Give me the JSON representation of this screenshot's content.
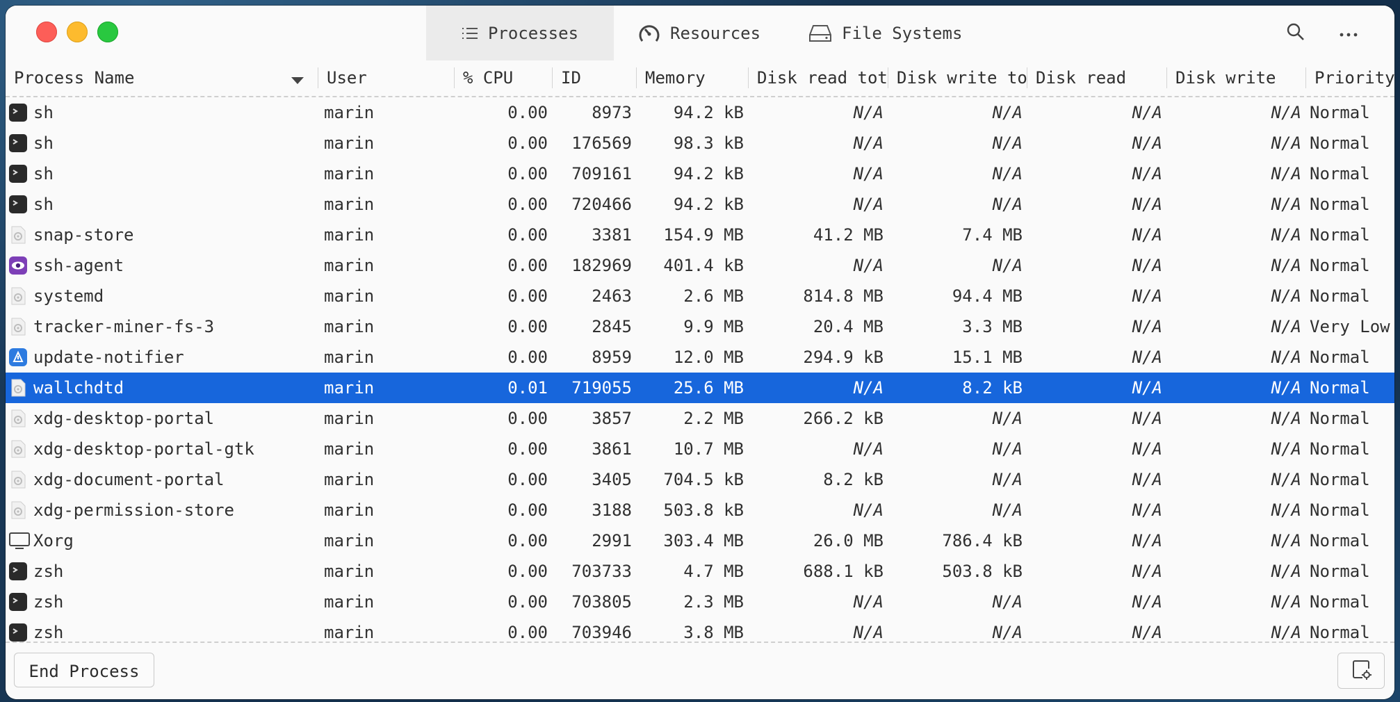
{
  "tabs": [
    {
      "label": "Processes",
      "icon": "list-icon",
      "active": true
    },
    {
      "label": "Resources",
      "icon": "speedometer-icon",
      "active": false
    },
    {
      "label": "File Systems",
      "icon": "drive-icon",
      "active": false
    }
  ],
  "columns": [
    "Process Name",
    "User",
    "% CPU",
    "ID",
    "Memory",
    "Disk read tota",
    "Disk write tot",
    "Disk read",
    "Disk write",
    "Priority"
  ],
  "sort_indicator": "chevron-down-icon",
  "rows": [
    {
      "name": "sh",
      "icon": "terminal-icon",
      "user": "marin",
      "cpu": "0.00",
      "id": "8973",
      "memory": "94.2 kB",
      "disk_read_total": "N/A",
      "disk_write_total": "N/A",
      "disk_read": "N/A",
      "disk_write": "N/A",
      "priority": "Normal"
    },
    {
      "name": "sh",
      "icon": "terminal-icon",
      "user": "marin",
      "cpu": "0.00",
      "id": "176569",
      "memory": "98.3 kB",
      "disk_read_total": "N/A",
      "disk_write_total": "N/A",
      "disk_read": "N/A",
      "disk_write": "N/A",
      "priority": "Normal"
    },
    {
      "name": "sh",
      "icon": "terminal-icon",
      "user": "marin",
      "cpu": "0.00",
      "id": "709161",
      "memory": "94.2 kB",
      "disk_read_total": "N/A",
      "disk_write_total": "N/A",
      "disk_read": "N/A",
      "disk_write": "N/A",
      "priority": "Normal"
    },
    {
      "name": "sh",
      "icon": "terminal-icon",
      "user": "marin",
      "cpu": "0.00",
      "id": "720466",
      "memory": "94.2 kB",
      "disk_read_total": "N/A",
      "disk_write_total": "N/A",
      "disk_read": "N/A",
      "disk_write": "N/A",
      "priority": "Normal"
    },
    {
      "name": "snap-store",
      "icon": "generic-app-icon",
      "user": "marin",
      "cpu": "0.00",
      "id": "3381",
      "memory": "154.9 MB",
      "disk_read_total": "41.2 MB",
      "disk_write_total": "7.4 MB",
      "disk_read": "N/A",
      "disk_write": "N/A",
      "priority": "Normal"
    },
    {
      "name": "ssh-agent",
      "icon": "eye-icon",
      "user": "marin",
      "cpu": "0.00",
      "id": "182969",
      "memory": "401.4 kB",
      "disk_read_total": "N/A",
      "disk_write_total": "N/A",
      "disk_read": "N/A",
      "disk_write": "N/A",
      "priority": "Normal"
    },
    {
      "name": "systemd",
      "icon": "generic-app-icon",
      "user": "marin",
      "cpu": "0.00",
      "id": "2463",
      "memory": "2.6 MB",
      "disk_read_total": "814.8 MB",
      "disk_write_total": "94.4 MB",
      "disk_read": "N/A",
      "disk_write": "N/A",
      "priority": "Normal"
    },
    {
      "name": "tracker-miner-fs-3",
      "icon": "generic-app-icon",
      "user": "marin",
      "cpu": "0.00",
      "id": "2845",
      "memory": "9.9 MB",
      "disk_read_total": "20.4 MB",
      "disk_write_total": "3.3 MB",
      "disk_read": "N/A",
      "disk_write": "N/A",
      "priority": "Very Low"
    },
    {
      "name": "update-notifier",
      "icon": "update-icon",
      "user": "marin",
      "cpu": "0.00",
      "id": "8959",
      "memory": "12.0 MB",
      "disk_read_total": "294.9 kB",
      "disk_write_total": "15.1 MB",
      "disk_read": "N/A",
      "disk_write": "N/A",
      "priority": "Normal"
    },
    {
      "name": "wallchdtd",
      "icon": "generic-app-icon",
      "user": "marin",
      "cpu": "0.01",
      "id": "719055",
      "memory": "25.6 MB",
      "disk_read_total": "N/A",
      "disk_write_total": "8.2 kB",
      "disk_read": "N/A",
      "disk_write": "N/A",
      "priority": "Normal",
      "selected": true
    },
    {
      "name": "xdg-desktop-portal",
      "icon": "generic-app-icon",
      "user": "marin",
      "cpu": "0.00",
      "id": "3857",
      "memory": "2.2 MB",
      "disk_read_total": "266.2 kB",
      "disk_write_total": "N/A",
      "disk_read": "N/A",
      "disk_write": "N/A",
      "priority": "Normal"
    },
    {
      "name": "xdg-desktop-portal-gtk",
      "icon": "generic-app-icon",
      "user": "marin",
      "cpu": "0.00",
      "id": "3861",
      "memory": "10.7 MB",
      "disk_read_total": "N/A",
      "disk_write_total": "N/A",
      "disk_read": "N/A",
      "disk_write": "N/A",
      "priority": "Normal"
    },
    {
      "name": "xdg-document-portal",
      "icon": "generic-app-icon",
      "user": "marin",
      "cpu": "0.00",
      "id": "3405",
      "memory": "704.5 kB",
      "disk_read_total": "8.2 kB",
      "disk_write_total": "N/A",
      "disk_read": "N/A",
      "disk_write": "N/A",
      "priority": "Normal"
    },
    {
      "name": "xdg-permission-store",
      "icon": "generic-app-icon",
      "user": "marin",
      "cpu": "0.00",
      "id": "3188",
      "memory": "503.8 kB",
      "disk_read_total": "N/A",
      "disk_write_total": "N/A",
      "disk_read": "N/A",
      "disk_write": "N/A",
      "priority": "Normal"
    },
    {
      "name": "Xorg",
      "icon": "monitor-icon",
      "user": "marin",
      "cpu": "0.00",
      "id": "2991",
      "memory": "303.4 MB",
      "disk_read_total": "26.0 MB",
      "disk_write_total": "786.4 kB",
      "disk_read": "N/A",
      "disk_write": "N/A",
      "priority": "Normal"
    },
    {
      "name": "zsh",
      "icon": "terminal-icon",
      "user": "marin",
      "cpu": "0.00",
      "id": "703733",
      "memory": "4.7 MB",
      "disk_read_total": "688.1 kB",
      "disk_write_total": "503.8 kB",
      "disk_read": "N/A",
      "disk_write": "N/A",
      "priority": "Normal"
    },
    {
      "name": "zsh",
      "icon": "terminal-icon",
      "user": "marin",
      "cpu": "0.00",
      "id": "703805",
      "memory": "2.3 MB",
      "disk_read_total": "N/A",
      "disk_write_total": "N/A",
      "disk_read": "N/A",
      "disk_write": "N/A",
      "priority": "Normal"
    },
    {
      "name": "zsh",
      "icon": "terminal-icon",
      "user": "marin",
      "cpu": "0.00",
      "id": "703946",
      "memory": "3.8 MB",
      "disk_read_total": "N/A",
      "disk_write_total": "N/A",
      "disk_read": "N/A",
      "disk_write": "N/A",
      "priority": "Normal"
    }
  ],
  "footer": {
    "end_process_label": "End Process",
    "settings_icon": "process-settings-icon"
  },
  "colors": {
    "selection": "#1766dc",
    "close": "#fd5e58",
    "minimize": "#fdbb2e",
    "maximize": "#29c840"
  }
}
